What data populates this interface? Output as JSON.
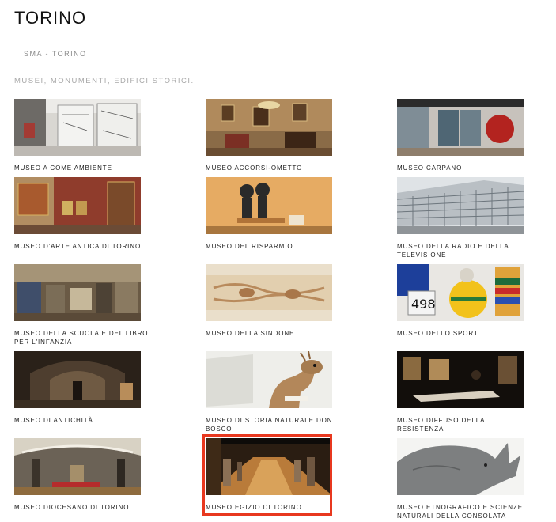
{
  "header": {
    "title": "TORINO",
    "breadcrumb": "SMA - TORINO",
    "subtitle": "MUSEI, MONUMENTI, EDIFICI STORICI."
  },
  "museums": [
    {
      "label": "MUSEO A COME AMBIENTE",
      "image": "museum-interior-photo"
    },
    {
      "label": "MUSEO ACCORSI-OMETTO",
      "image": "museum-interior-photo"
    },
    {
      "label": "MUSEO CARPANO",
      "image": "museum-interior-photo"
    },
    {
      "label": "MUSEO D'ARTE ANTICA DI TORINO",
      "image": "museum-interior-photo"
    },
    {
      "label": "MUSEO DEL RISPARMIO",
      "image": "museum-interior-photo"
    },
    {
      "label": "MUSEO DELLA RADIO E DELLA TELEVISIONE",
      "image": "building-facade-photo"
    },
    {
      "label": "MUSEO DELLA SCUOLA E DEL LIBRO PER L'INFANZIA",
      "image": "museum-interior-photo"
    },
    {
      "label": "MUSEO DELLA SINDONE",
      "image": "shroud-photo"
    },
    {
      "label": "MUSEO DELLO SPORT",
      "image": "sport-memorabilia-photo"
    },
    {
      "label": "MUSEO DI ANTICHITÀ",
      "image": "museum-interior-photo"
    },
    {
      "label": "MUSEO DI STORIA NATURALE DON BOSCO",
      "image": "deer-taxidermy-photo"
    },
    {
      "label": "MUSEO DIFFUSO DELLA RESISTENZA",
      "image": "museum-interior-photo"
    },
    {
      "label": "MUSEO DIOCESANO DI TORINO",
      "image": "museum-interior-photo"
    },
    {
      "label": "MUSEO EGIZIO DI TORINO",
      "image": "egyptian-gallery-photo"
    },
    {
      "label": "MUSEO ETNOGRAFICO E SCIENZE NATURALI DELLA CONSOLATA",
      "image": "rhino-photo"
    }
  ],
  "selected_label": "MUSEO EGIZIO DI TORINO",
  "colors": {
    "highlight": "#e8381f",
    "breadcrumb": "#8a8a8a",
    "subtitle": "#a8a8a8"
  }
}
